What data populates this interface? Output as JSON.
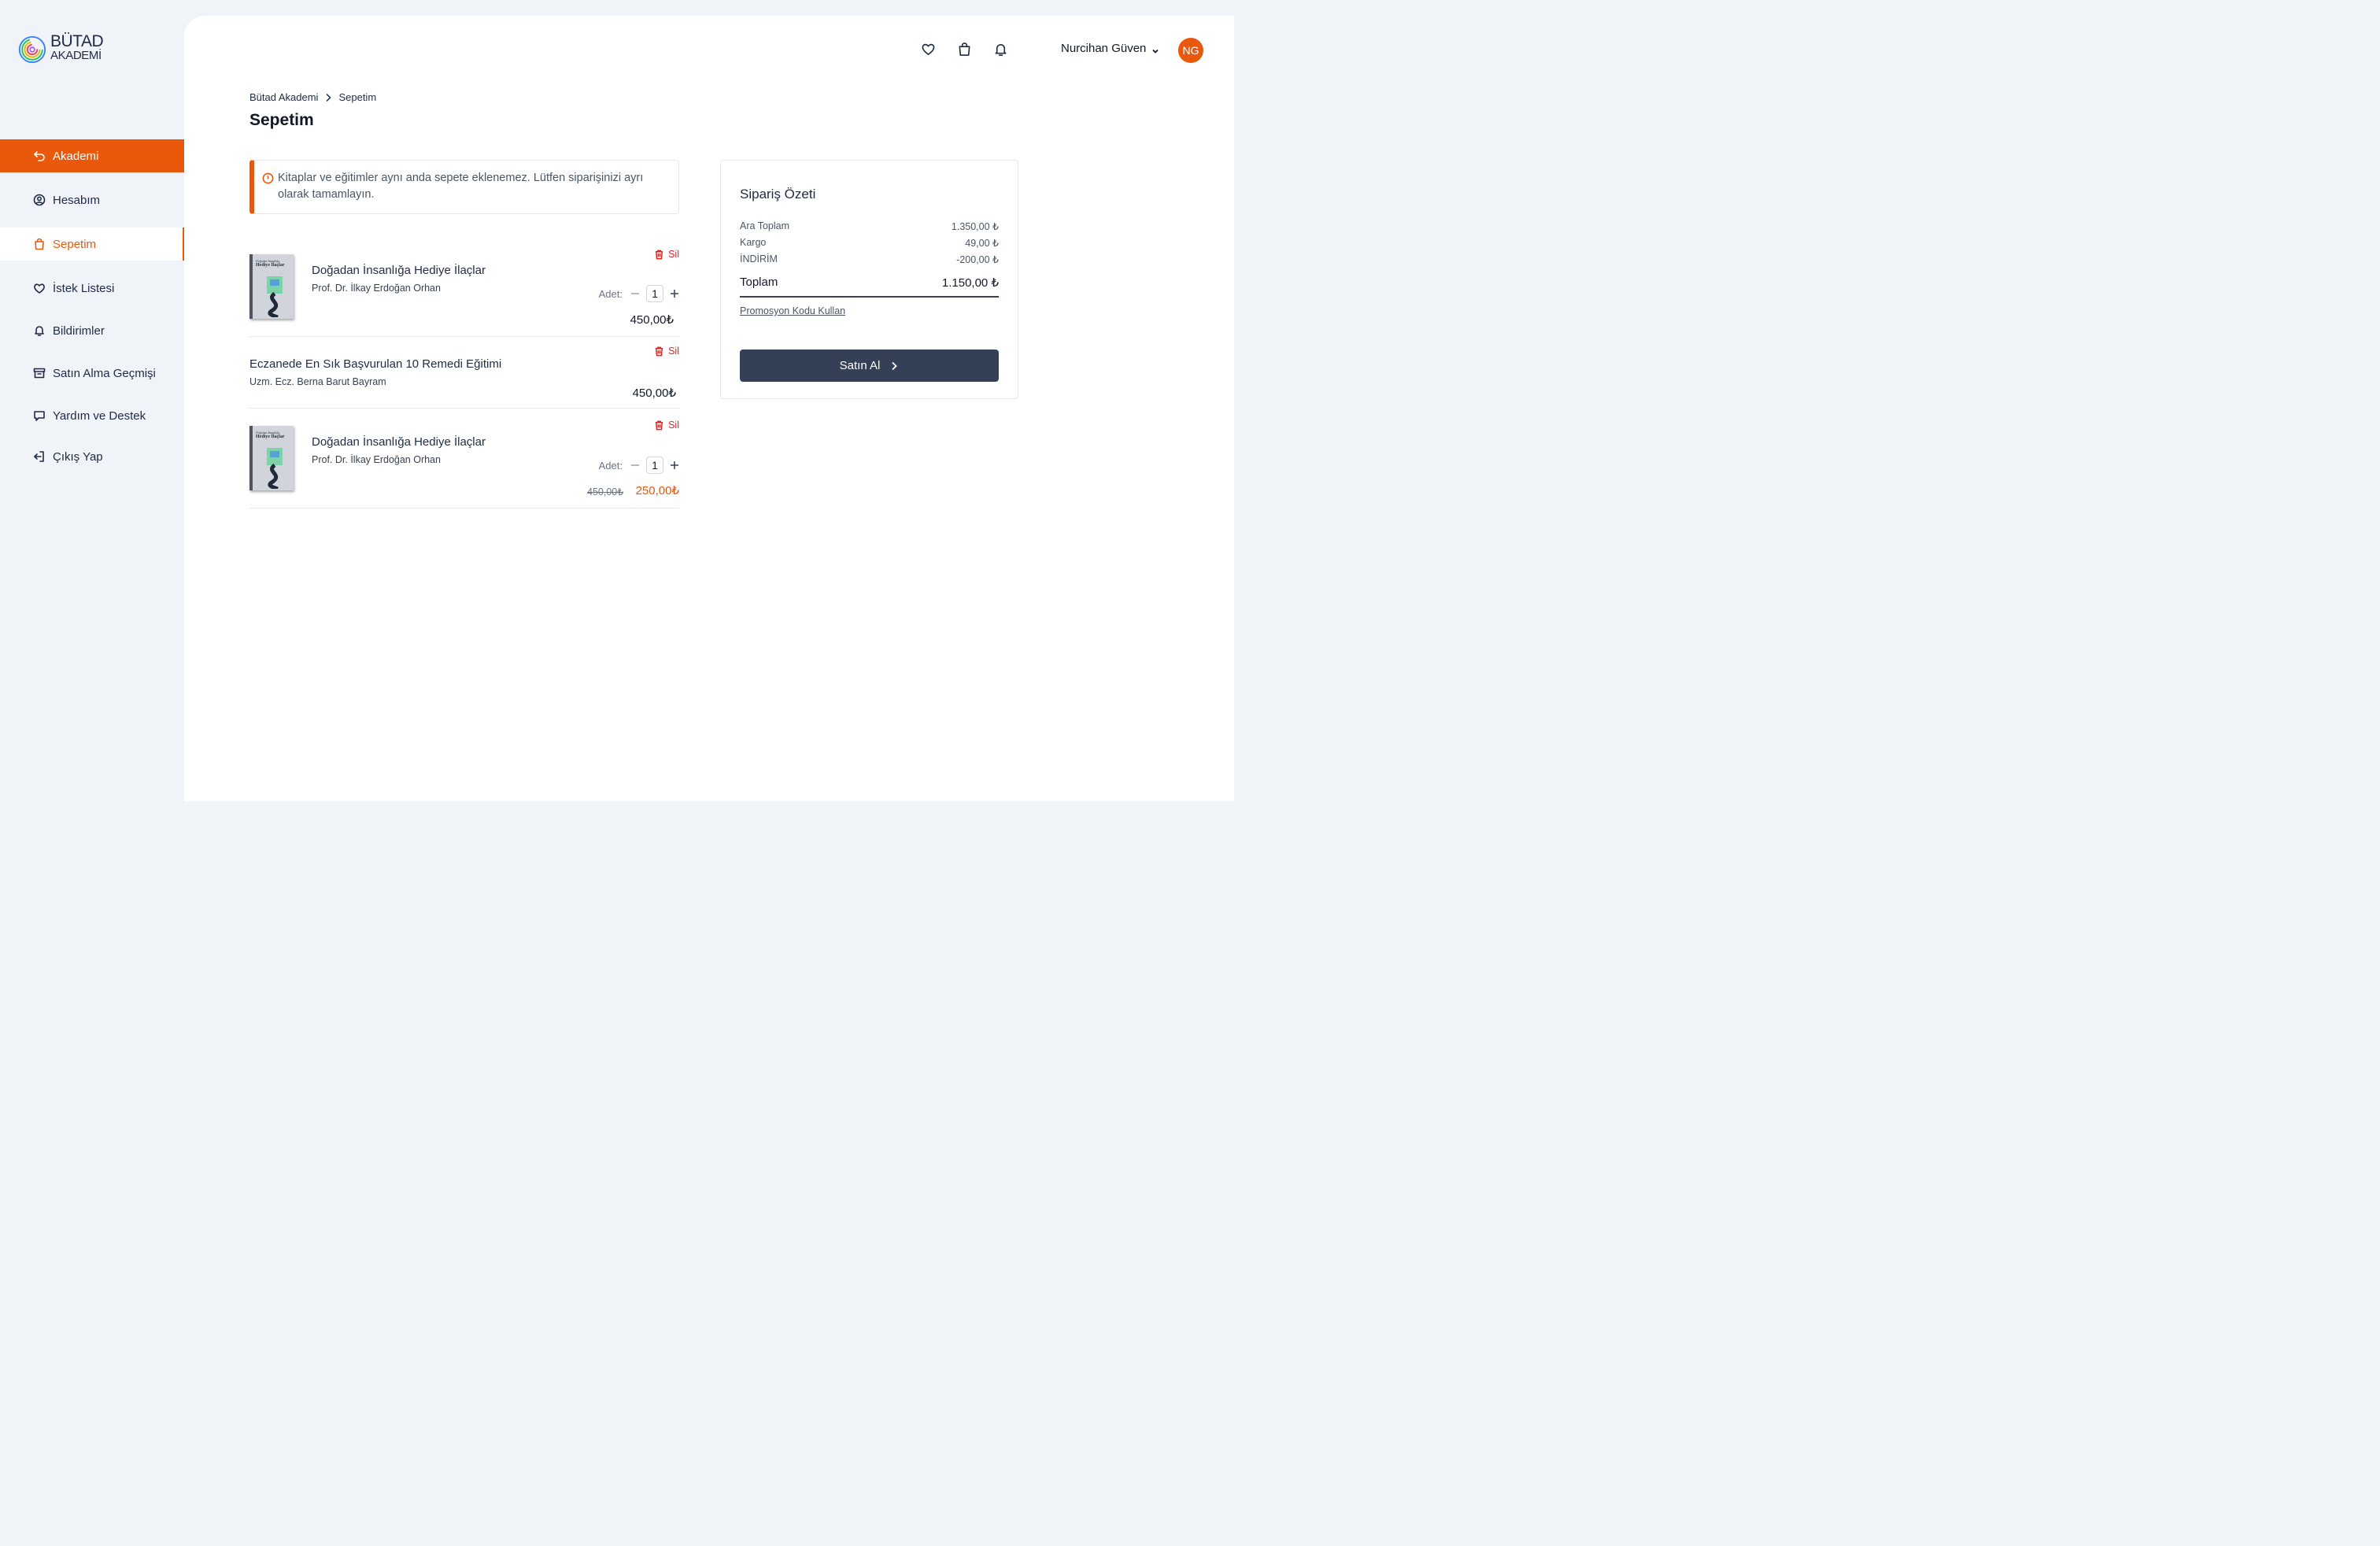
{
  "brand": {
    "line1": "BÜTAD",
    "line2": "AKADEMİ"
  },
  "sidebar": {
    "items": [
      {
        "label": "Akademi",
        "icon": "undo-arrow-icon"
      },
      {
        "label": "Hesabım",
        "icon": "user-circle-icon"
      },
      {
        "label": "Sepetim",
        "icon": "shopping-bag-icon"
      },
      {
        "label": "İstek Listesi",
        "icon": "heart-icon"
      },
      {
        "label": "Bildirimler",
        "icon": "bell-icon"
      },
      {
        "label": "Satın Alma Geçmişi",
        "icon": "archive-icon"
      },
      {
        "label": "Yardım ve Destek",
        "icon": "chat-bubble-icon"
      },
      {
        "label": "Çıkış Yap",
        "icon": "logout-icon"
      }
    ]
  },
  "header": {
    "user_name": "Nurcihan Güven",
    "avatar_initials": "NG"
  },
  "breadcrumb": {
    "root": "Bütad Akademi",
    "current": "Sepetim"
  },
  "page_title": "Sepetim",
  "alert": {
    "text": "Kitaplar ve eğitimler aynı anda sepete eklenemez. Lütfen siparişinizi ayrı olarak tamamlayın."
  },
  "cart": {
    "delete_label": "Sil",
    "qty_label": "Adet:",
    "items": [
      {
        "title": "Doğadan İnsanlığa Hediye İlaçlar",
        "author": "Prof. Dr. İlkay Erdoğan Orhan",
        "qty": "1",
        "price": "450,00₺",
        "cover_line1": "Doğadan İnsanlığa",
        "cover_line2": "Hediye İlaçlar"
      },
      {
        "title": "Eczanede En Sık Başvurulan 10 Remedi Eğitimi",
        "author": "Uzm. Ecz. Berna Barut Bayram",
        "price": "450,00₺"
      },
      {
        "title": "Doğadan İnsanlığa Hediye İlaçlar",
        "author": "Prof. Dr. İlkay Erdoğan Orhan",
        "qty": "1",
        "old_price": "450,00₺",
        "price": "250,00₺",
        "cover_line1": "Doğadan İnsanlığa",
        "cover_line2": "Hediye İlaçlar"
      }
    ]
  },
  "summary": {
    "title": "Sipariş Özeti",
    "rows": [
      {
        "label": "Ara Toplam",
        "value": "1.350,00 ₺"
      },
      {
        "label": "Kargo",
        "value": "49,00 ₺"
      },
      {
        "label": "İNDİRİM",
        "value": "-200,00 ₺"
      }
    ],
    "total_label": "Toplam",
    "total_value": "1.150,00 ₺",
    "promo_label": "Promosyon Kodu Kullan",
    "buy_label": "Satın Al"
  },
  "colors": {
    "accent": "#ea580c",
    "danger": "#dc2626",
    "button": "#344055"
  }
}
